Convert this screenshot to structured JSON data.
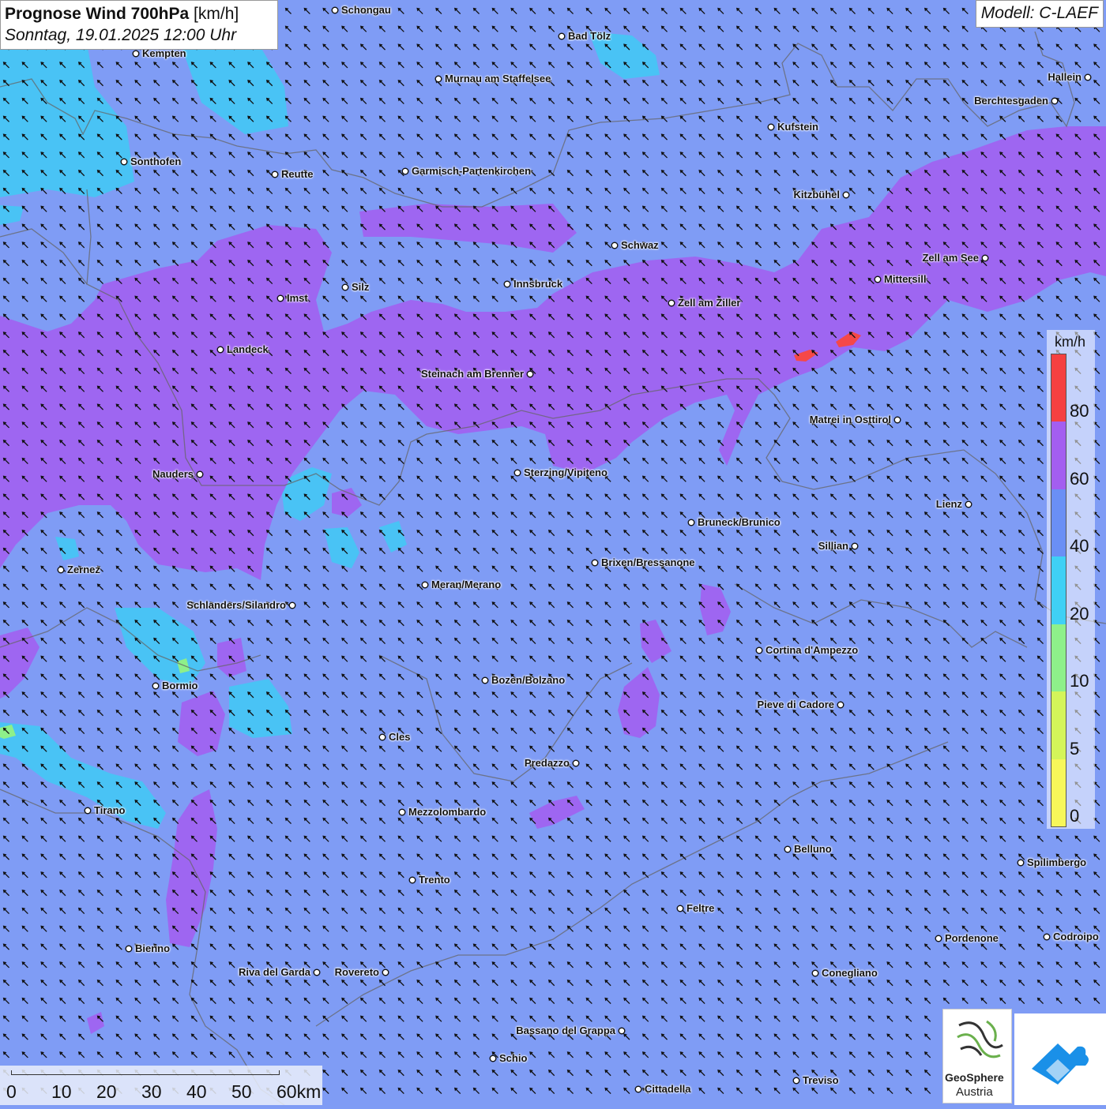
{
  "header": {
    "title_bold": "Prognose Wind 700hPa",
    "title_unit": "[km/h]",
    "subtitle": "Sonntag, 19.01.2025 12:00 Uhr",
    "model": "Modell: C-LAEF"
  },
  "legend": {
    "unit": "km/h",
    "stops": [
      {
        "label": "0",
        "color": "#f7f75a"
      },
      {
        "label": "5",
        "color": "#d4f55a"
      },
      {
        "label": "10",
        "color": "#8ef08a"
      },
      {
        "label": "20",
        "color": "#3fd0f5"
      },
      {
        "label": "40",
        "color": "#6a8ff5"
      },
      {
        "label": "60",
        "color": "#a35ef0"
      },
      {
        "label": "80",
        "color": "#f54040"
      }
    ]
  },
  "cities": [
    {
      "name": "Schongau"
    },
    {
      "name": "Bad Tölz"
    },
    {
      "name": "Kempten"
    },
    {
      "name": "Murnau am Staffelsee"
    },
    {
      "name": "Hallein"
    },
    {
      "name": "Berchtesgaden"
    },
    {
      "name": "Kufstein"
    },
    {
      "name": "Sonthofen"
    },
    {
      "name": "Reutte"
    },
    {
      "name": "Garmisch-Partenkirchen"
    },
    {
      "name": "Kitzbühel"
    },
    {
      "name": "Schwaz"
    },
    {
      "name": "Zell am See"
    },
    {
      "name": "Silz"
    },
    {
      "name": "Innsbruck"
    },
    {
      "name": "Mittersill"
    },
    {
      "name": "Imst"
    },
    {
      "name": "Zell am Ziller"
    },
    {
      "name": "Landeck"
    },
    {
      "name": "Steinach am Brenner"
    },
    {
      "name": "Matrei in Osttirol"
    },
    {
      "name": "Nauders"
    },
    {
      "name": "Sterzing/Vipiteno"
    },
    {
      "name": "Lienz"
    },
    {
      "name": "Bruneck/Brunico"
    },
    {
      "name": "Sillian"
    },
    {
      "name": "Zernez"
    },
    {
      "name": "Brixen/Bressanone"
    },
    {
      "name": "Meran/Merano"
    },
    {
      "name": "Schlanders/Silandro"
    },
    {
      "name": "Cortina d'Ampezzo"
    },
    {
      "name": "Bozen/Bolzano"
    },
    {
      "name": "Bormio"
    },
    {
      "name": "Pieve di Cadore"
    },
    {
      "name": "Cles"
    },
    {
      "name": "Predazzo"
    },
    {
      "name": "Tirano"
    },
    {
      "name": "Mezzolombardo"
    },
    {
      "name": "Belluno"
    },
    {
      "name": "Spilimbergo"
    },
    {
      "name": "Trento"
    },
    {
      "name": "Feltre"
    },
    {
      "name": "Pordenone"
    },
    {
      "name": "Codroipo"
    },
    {
      "name": "Bienno"
    },
    {
      "name": "Riva del Garda"
    },
    {
      "name": "Rovereto"
    },
    {
      "name": "Conegliano"
    },
    {
      "name": "Bassano del Grappa"
    },
    {
      "name": "Schio"
    },
    {
      "name": "Treviso"
    },
    {
      "name": "Cittadella"
    }
  ],
  "scale": {
    "ticks": [
      "0",
      "10",
      "20",
      "30",
      "40",
      "50"
    ],
    "last": "60km"
  },
  "logos": {
    "geosphere_line1": "GeoSphere",
    "geosphere_line2": "Austria"
  }
}
